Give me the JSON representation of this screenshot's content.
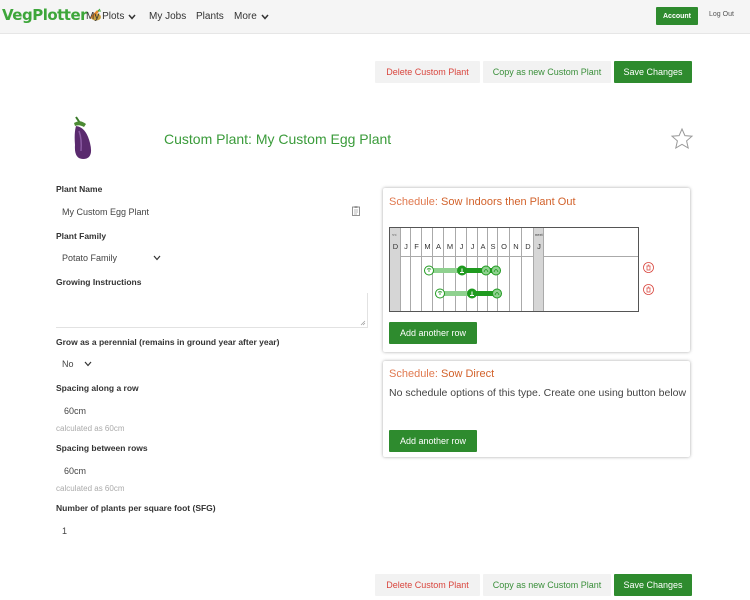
{
  "nav": {
    "logo": "VegPlotter",
    "items": [
      "My Plots",
      "My Jobs",
      "Plants",
      "More"
    ],
    "account": "Account",
    "logout": "Log Out"
  },
  "actions": {
    "delete": "Delete Custom Plant",
    "copy": "Copy as new Custom Plant",
    "save": "Save Changes"
  },
  "header": {
    "title": "Custom Plant: My Custom Egg Plant"
  },
  "form": {
    "plant_name_label": "Plant Name",
    "plant_name": "My Custom Egg Plant",
    "family_label": "Plant Family",
    "family": "Potato Family",
    "instructions_label": "Growing Instructions",
    "instructions": "",
    "perennial_label": "Grow as a perennial (remains in ground year after year)",
    "perennial": "No",
    "spacing_row_label": "Spacing along a row",
    "spacing_row": "60cm",
    "spacing_row_hint": "calculated as 60cm",
    "spacing_between_label": "Spacing between rows",
    "spacing_between": "60cm",
    "spacing_between_hint": "calculated as 60cm",
    "sfg_label": "Number of plants per square foot (SFG)",
    "sfg": "1"
  },
  "schedule1": {
    "prefix": "Schedule: ",
    "name": "Sow Indoors then Plant Out",
    "prev_label": "<<",
    "next_label": "next",
    "months": [
      "D",
      "J",
      "F",
      "M",
      "A",
      "M",
      "J",
      "J",
      "A",
      "S",
      "O",
      "N",
      "D",
      "J"
    ],
    "add_row": "Add another row"
  },
  "schedule2": {
    "prefix": "Schedule: ",
    "name": "Sow Direct",
    "empty_text": "No schedule options of this type. Create one using button below",
    "add_row": "Add another row"
  },
  "colors": {
    "brand_green": "#2e8b2e",
    "logo_green": "#3da63a",
    "title_green": "#3a9b3a",
    "delete_red": "#d9463e",
    "schedule_orange": "#d2622b",
    "bar_light": "#8fd18f",
    "bar_dark": "#1f9a1f"
  },
  "icons": [
    "logo-carrot-icon",
    "chevron-down-icon",
    "eggplant-image",
    "star-icon",
    "clipboard-icon",
    "sow-icon",
    "plant-out-icon",
    "harvest-icon",
    "delete-row-icon",
    "resize-handle-icon"
  ]
}
